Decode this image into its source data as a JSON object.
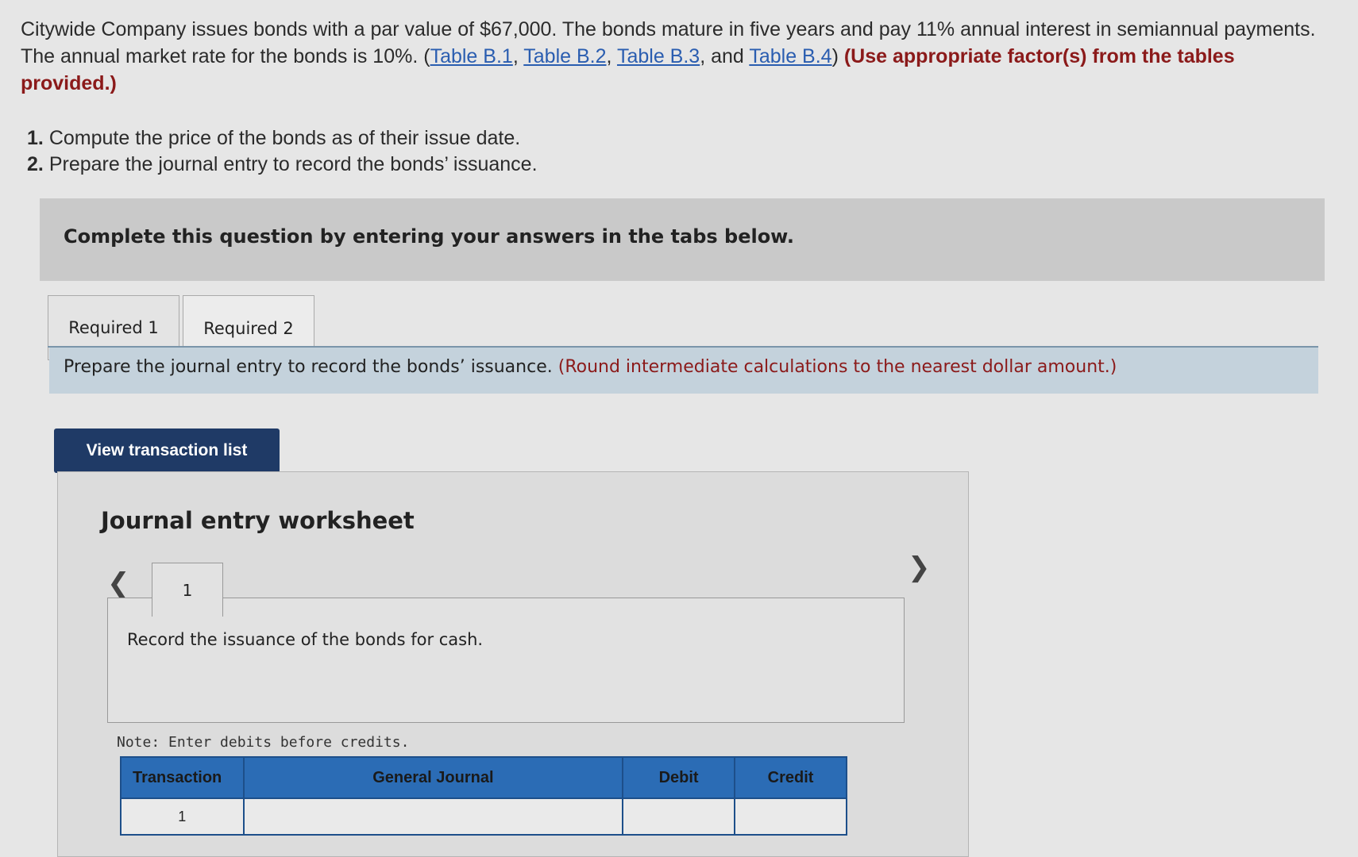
{
  "problem": {
    "text_1": "Citywide Company issues bonds with a par value of $67,000. The bonds mature in five years and pay 11% annual interest in semiannual payments. The annual market rate for the bonds is 10%. (",
    "links": [
      "Table B.1",
      "Table B.2",
      "Table B.3",
      "Table B.4"
    ],
    "sep_1": ", ",
    "sep_2": ", ",
    "sep_3": ", and ",
    "text_2": ") ",
    "bold_note": "(Use appropriate factor(s) from the tables provided.)"
  },
  "requirements": [
    {
      "num": "1.",
      "text": "Compute the price of the bonds as of their issue date."
    },
    {
      "num": "2.",
      "text": "Prepare the journal entry to record the bonds’ issuance."
    }
  ],
  "banner": "Complete this question by entering your answers in the tabs below.",
  "tabs": [
    {
      "label": "Required 1"
    },
    {
      "label": "Required 2"
    }
  ],
  "instruction": {
    "text": "Prepare the journal entry to record the bonds’ issuance. ",
    "note": "(Round intermediate calculations to the nearest dollar amount.)"
  },
  "view_button": "View transaction list",
  "worksheet": {
    "title": "Journal entry worksheet",
    "entry_tab": "1",
    "entry_description": "Record the issuance of the bonds for cash.",
    "note": "Note: Enter debits before credits.",
    "columns": [
      "Transaction",
      "General Journal",
      "Debit",
      "Credit"
    ],
    "rows": [
      {
        "transaction": "1",
        "account": "",
        "debit": "",
        "credit": ""
      }
    ]
  }
}
